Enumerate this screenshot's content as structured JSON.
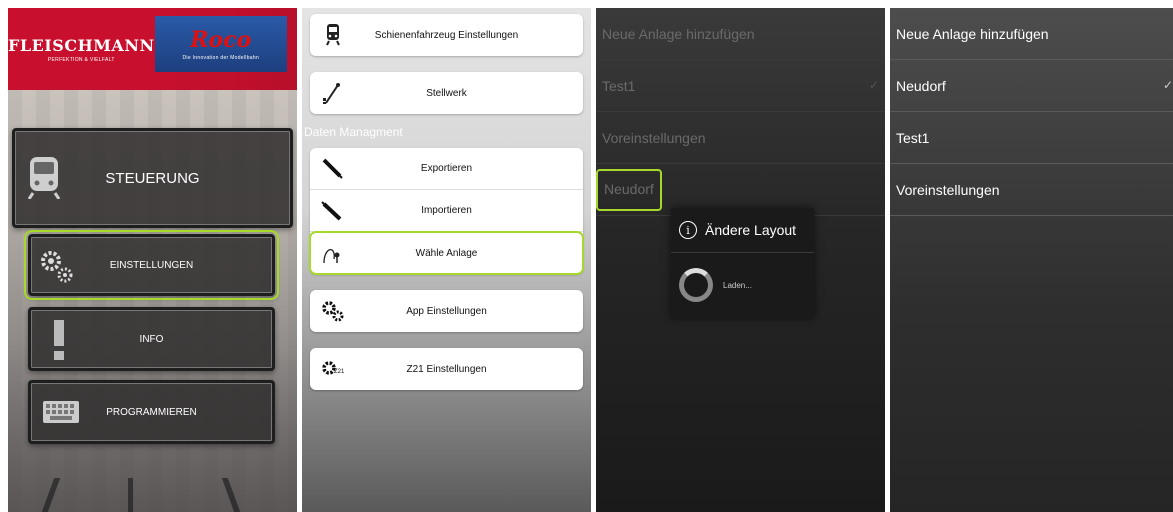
{
  "screen1": {
    "brand_left_title": "FLEISCHMANN",
    "brand_left_sub": "PERFEKTION & VIELFALT",
    "brand_right_title": "Roco",
    "brand_right_sub": "Die Innovation der Modellbahn",
    "tiles": {
      "steuerung": "STEUERUNG",
      "einstellungen": "EINSTELLUNGEN",
      "info": "INFO",
      "programmieren": "PROGRAMMIEREN"
    }
  },
  "screen2": {
    "items_top": [
      "Schienenfahrzeug Einstellungen",
      "Stellwerk"
    ],
    "section_label": "Daten Managment",
    "data_items": [
      "Exportieren",
      "Importieren",
      "Wähle Anlage"
    ],
    "app_settings": "App Einstellungen",
    "z21_settings": "Z21 Einstellungen",
    "z21_icon_text": "Z21"
  },
  "screen3": {
    "list": [
      "Neue Anlage hinzufügen",
      "Test1",
      "Voreinstellungen",
      "Neudorf"
    ],
    "dialog_title": "Ändere Layout",
    "dialog_message": "Laden..."
  },
  "screen4": {
    "list": [
      "Neue Anlage hinzufügen",
      "Neudorf",
      "Test1",
      "Voreinstellungen"
    ]
  },
  "colors": {
    "accent_green": "#a6d92a",
    "brand_red": "#c8102e",
    "brand_blue": "#2a5aa8"
  }
}
